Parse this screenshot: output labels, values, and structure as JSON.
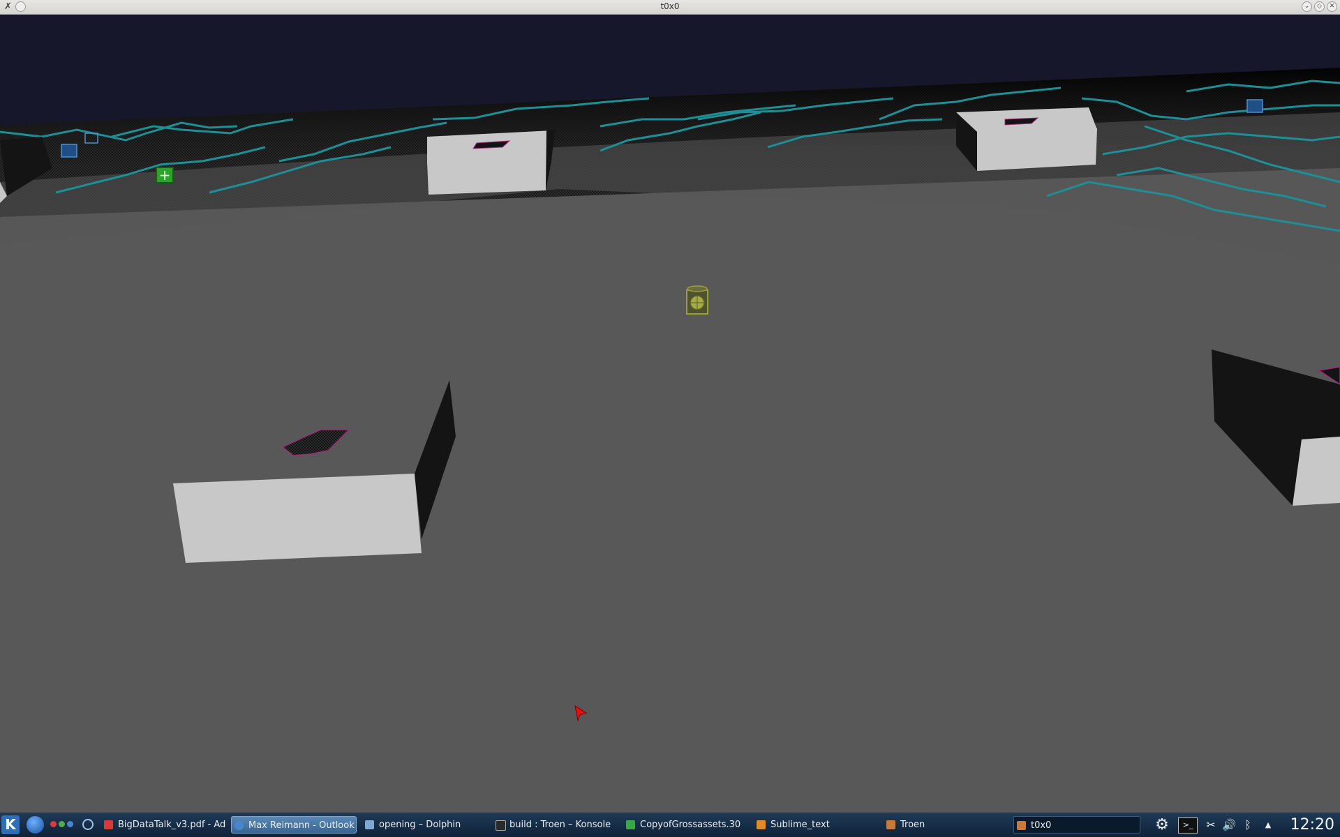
{
  "window": {
    "title": "t0x0",
    "close_glyph": "✕",
    "maximize_glyph": "◇",
    "minimize_glyph": "⌄"
  },
  "scene": {
    "sky_color": "#16172a",
    "floor_color": "#585858",
    "grid_color": "#1e8f96",
    "block_top_color": "#c8c8c8",
    "block_side_color": "#141414"
  },
  "taskbar": {
    "start_icon": "kde-k-icon",
    "launchers": [
      "firefox-icon",
      "activities-dots-icon",
      "network-icon"
    ],
    "items": [
      {
        "label": "BigDataTalk_v3.pdf - Ad",
        "icon": "pdf-icon",
        "active": false
      },
      {
        "label": "Max Reimann - Outlook",
        "icon": "firefox-icon",
        "active": true
      },
      {
        "label": "opening – Dolphin",
        "icon": "folder-icon",
        "active": false
      },
      {
        "label": "build : Troen – Konsole",
        "icon": "terminal-icon",
        "active": false
      },
      {
        "label": "CopyofGrossassets.30",
        "icon": "spreadsheet-icon",
        "active": false
      },
      {
        "label": "Sublime_text",
        "icon": "editor-icon",
        "active": false
      },
      {
        "label": "Troen",
        "icon": "troen-icon",
        "active": false
      }
    ],
    "pager_label": "t0x0",
    "clock": "12:20"
  }
}
